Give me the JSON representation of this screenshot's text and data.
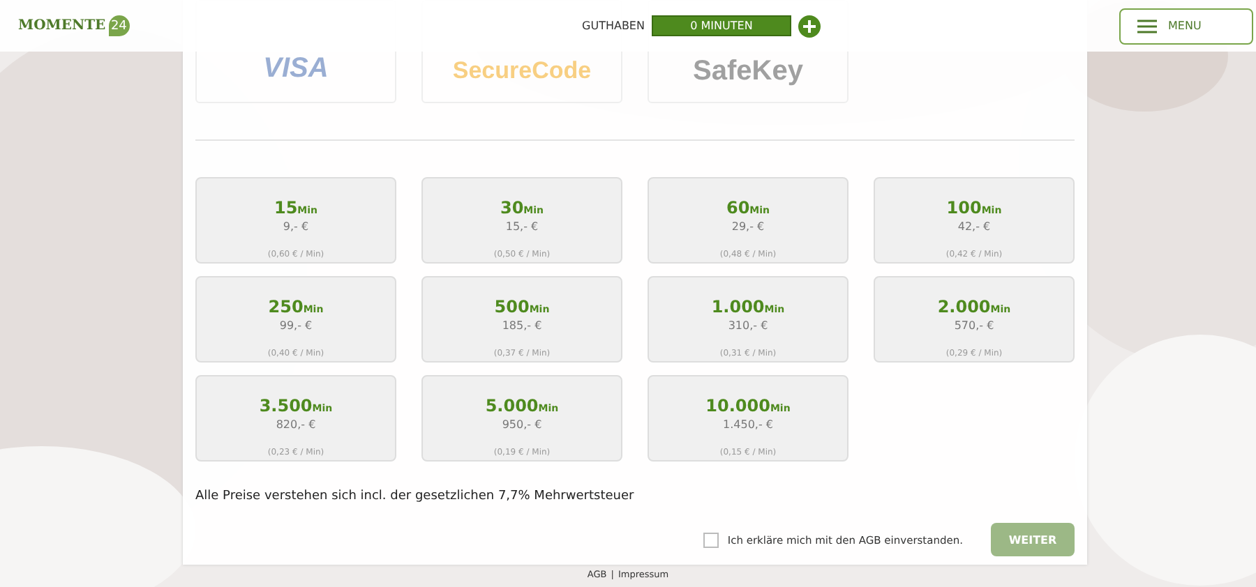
{
  "header": {
    "logo_text": "MOMENTE",
    "logo_badge": "24",
    "balance_label": "GUTHABEN",
    "balance_value": "0 MINUTEN",
    "menu_label": "MENU"
  },
  "payment_logos": [
    {
      "kind": "visa",
      "text": "VISA"
    },
    {
      "kind": "mastercard",
      "text": "SecureCode"
    },
    {
      "kind": "safekey",
      "text": "SafeKey"
    }
  ],
  "packages": [
    {
      "amount": "15",
      "unit": "Min",
      "price": "9,- €",
      "per_minute": "(0,60 € / Min)"
    },
    {
      "amount": "30",
      "unit": "Min",
      "price": "15,- €",
      "per_minute": "(0,50 € / Min)"
    },
    {
      "amount": "60",
      "unit": "Min",
      "price": "29,- €",
      "per_minute": "(0,48 € / Min)"
    },
    {
      "amount": "100",
      "unit": "Min",
      "price": "42,- €",
      "per_minute": "(0,42 € / Min)"
    },
    {
      "amount": "250",
      "unit": "Min",
      "price": "99,- €",
      "per_minute": "(0,40 € / Min)"
    },
    {
      "amount": "500",
      "unit": "Min",
      "price": "185,- €",
      "per_minute": "(0,37 € / Min)"
    },
    {
      "amount": "1.000",
      "unit": "Min",
      "price": "310,- €",
      "per_minute": "(0,31 € / Min)"
    },
    {
      "amount": "2.000",
      "unit": "Min",
      "price": "570,- €",
      "per_minute": "(0,29 € / Min)"
    },
    {
      "amount": "3.500",
      "unit": "Min",
      "price": "820,- €",
      "per_minute": "(0,23 € / Min)"
    },
    {
      "amount": "5.000",
      "unit": "Min",
      "price": "950,- €",
      "per_minute": "(0,19 € / Min)"
    },
    {
      "amount": "10.000",
      "unit": "Min",
      "price": "1.450,- €",
      "per_minute": "(0,15 € / Min)"
    }
  ],
  "vat_note": "Alle Preise verstehen sich incl. der gesetzlichen 7,7% Mehrwertsteuer",
  "agb_consent": {
    "label": "Ich erkläre mich mit den AGB einverstanden.",
    "checked": false
  },
  "continue_button": {
    "label": "WEITER",
    "disabled": true
  },
  "footer_links": [
    "AGB",
    "Impressum"
  ],
  "footer_separator": "|"
}
